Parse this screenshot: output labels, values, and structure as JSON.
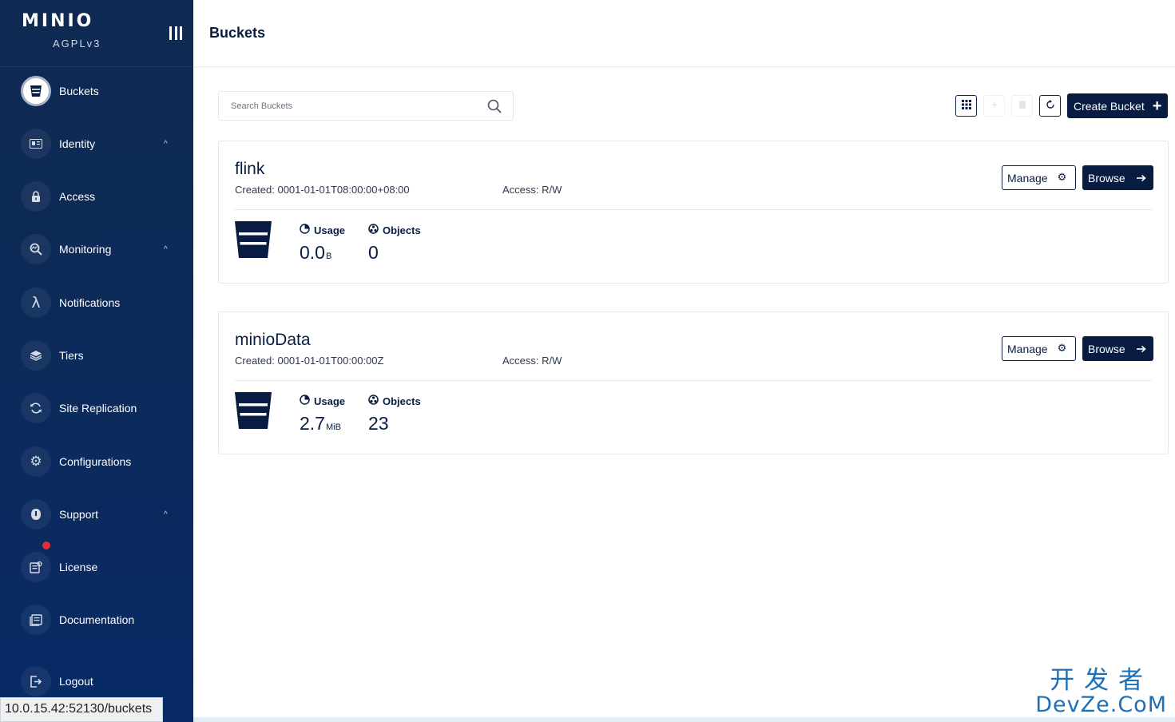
{
  "sidebar": {
    "logo": "MINIO",
    "license_type": "AGPLv3",
    "items": [
      {
        "label": "Buckets",
        "icon": "bucket-icon"
      },
      {
        "label": "Identity",
        "icon": "identity-card-icon"
      },
      {
        "label": "Access",
        "icon": "lock-icon"
      },
      {
        "label": "Monitoring",
        "icon": "monitoring-search-icon"
      },
      {
        "label": "Notifications",
        "icon": "lambda-icon"
      },
      {
        "label": "Tiers",
        "icon": "layers-icon"
      },
      {
        "label": "Site Replication",
        "icon": "replication-icon"
      },
      {
        "label": "Configurations",
        "icon": "gear-icon"
      },
      {
        "label": "Support",
        "icon": "support-icon"
      },
      {
        "label": "License",
        "icon": "license-icon"
      },
      {
        "label": "Documentation",
        "icon": "documentation-icon"
      },
      {
        "label": "Logout",
        "icon": "logout-icon"
      }
    ]
  },
  "status_url": "10.0.15.42:52130/buckets",
  "header": {
    "title": "Buckets"
  },
  "toolbar": {
    "search_placeholder": "Search Buckets",
    "create_label": "Create Bucket"
  },
  "buckets": [
    {
      "name": "flink",
      "created": "Created: 0001-01-01T08:00:00+08:00",
      "access": "Access: R/W",
      "usage_label": "Usage",
      "usage_value": "0.0",
      "usage_unit": "B",
      "objects_label": "Objects",
      "objects_value": "0",
      "manage_label": "Manage",
      "browse_label": "Browse"
    },
    {
      "name": "minioData",
      "created": "Created: 0001-01-01T00:00:00Z",
      "access": "Access: R/W",
      "usage_label": "Usage",
      "usage_value": "2.7",
      "usage_unit": "MiB",
      "objects_label": "Objects",
      "objects_value": "23",
      "manage_label": "Manage",
      "browse_label": "Browse"
    }
  ],
  "watermark": {
    "top": "开发者",
    "bottom": "DevZe.CoM"
  },
  "colors": {
    "sidebar": "#0c2a5a",
    "primary": "#081c42",
    "notification_dot": "#e0303b"
  }
}
